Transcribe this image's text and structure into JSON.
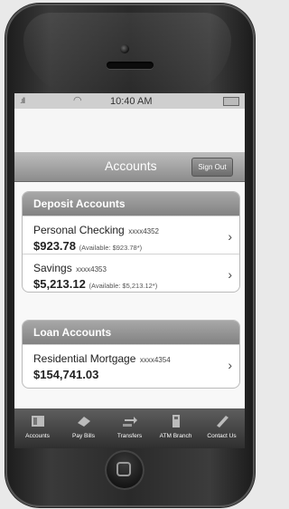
{
  "status": {
    "time": "10:40 AM"
  },
  "navbar": {
    "title": "Accounts",
    "sign_out": "Sign Out"
  },
  "deposit_accounts": {
    "header": "Deposit Accounts",
    "items": [
      {
        "name": "Personal Checking",
        "number": "xxxx4352",
        "balance": "$923.78",
        "available": "(Available: $923.78*)"
      },
      {
        "name": "Savings",
        "number": "xxxx4353",
        "balance": "$5,213.12",
        "available": "(Available: $5,213.12*)"
      }
    ]
  },
  "loan_accounts": {
    "header": "Loan Accounts",
    "items": [
      {
        "name": "Residential Mortgage",
        "number": "xxxx4354",
        "balance": "$154,741.03"
      }
    ]
  },
  "tabs": [
    {
      "label": "Accounts",
      "icon": "accounts-icon"
    },
    {
      "label": "Pay Bills",
      "icon": "pay-bills-icon"
    },
    {
      "label": "Transfers",
      "icon": "transfers-icon"
    },
    {
      "label": "ATM Branch",
      "icon": "atm-branch-icon"
    },
    {
      "label": "Contact Us",
      "icon": "contact-us-icon"
    }
  ]
}
